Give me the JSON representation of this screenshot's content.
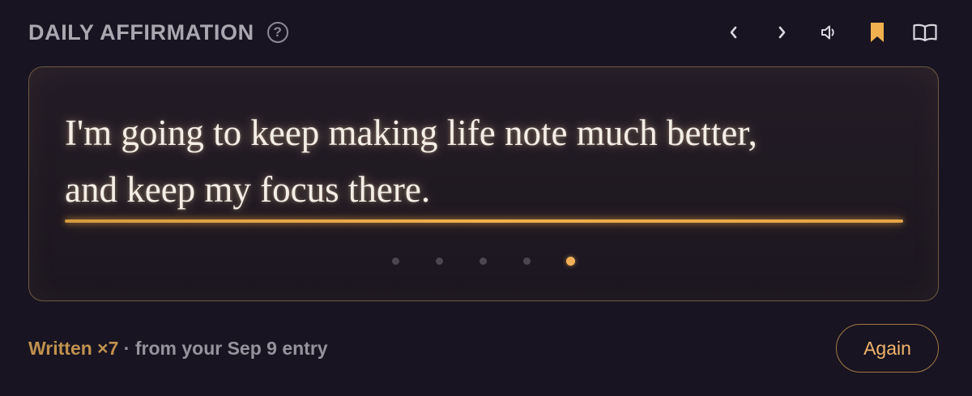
{
  "header": {
    "title": "DAILY AFFIRMATION",
    "help_glyph": "?"
  },
  "toolbar": {
    "items": [
      {
        "icon": "chevron-left-icon",
        "glyph": "‹"
      },
      {
        "icon": "chevron-right-icon",
        "glyph": "›"
      },
      {
        "icon": "speaker-icon"
      },
      {
        "icon": "bookmark-icon",
        "active": true
      },
      {
        "icon": "book-icon"
      }
    ]
  },
  "affirmation": {
    "line1": "I'm going to keep making life note much better,",
    "line2": "and keep my focus there."
  },
  "pager": {
    "count": 5,
    "active_index": 4
  },
  "footer": {
    "count_text": "Written ×7",
    "separator": " · ",
    "source_text": "from your Sep 9 entry",
    "again_label": "Again"
  },
  "colors": {
    "background": "#181421",
    "accent": "#f2b04f",
    "muted_text": "#96939d",
    "quote_text": "#f4eee6",
    "count_text": "#c0914f"
  }
}
